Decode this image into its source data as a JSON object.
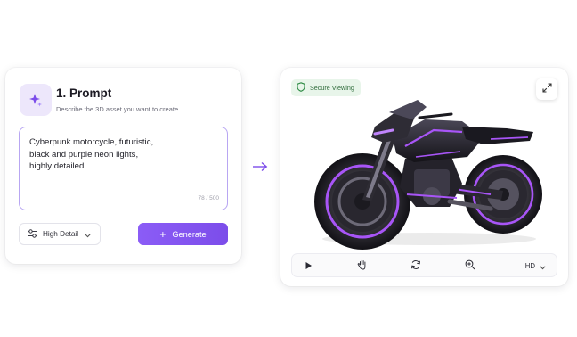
{
  "prompt_panel": {
    "step_title": "1. Prompt",
    "step_description": "Describe the 3D asset you want to create.",
    "prompt_lines": [
      "Cyberpunk motorcycle, futuristic,",
      "black and purple neon lights,",
      "highly detailed"
    ],
    "char_count": "78 / 500",
    "detail_select": {
      "label": "High Detail"
    },
    "generate_button": {
      "label": "Generate"
    }
  },
  "viewer": {
    "secure_badge": "Secure Viewing",
    "quality_select": "HD",
    "toolbar": {
      "icons": [
        "play-icon",
        "hand-pan-icon",
        "rotate-icon",
        "zoom-in-icon"
      ]
    },
    "model_subject": "Cyberpunk motorcycle"
  },
  "colors": {
    "accent": "#8b5cf6",
    "accent_light": "#ede7fb",
    "secure_green": "#2e8b45",
    "neon_purple": "#a855f7"
  }
}
